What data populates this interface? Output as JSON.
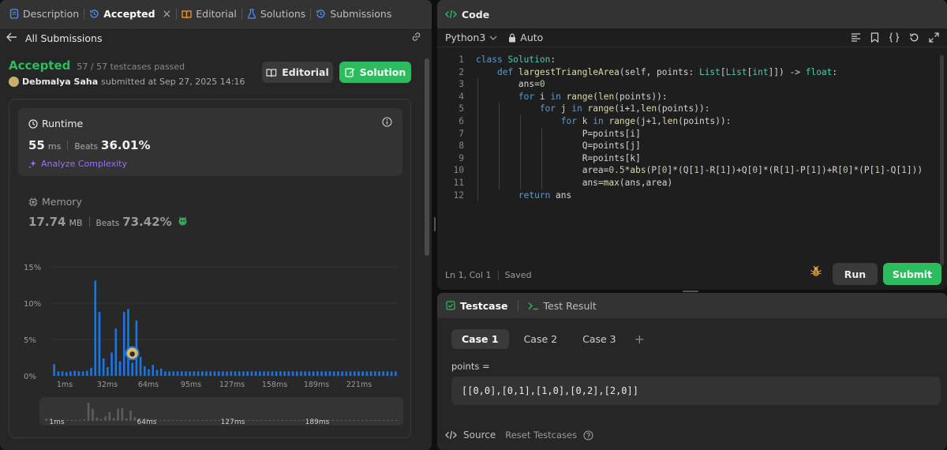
{
  "left_tabs": [
    {
      "label": "Description"
    },
    {
      "label": "Accepted"
    },
    {
      "label": "Editorial"
    },
    {
      "label": "Solutions"
    },
    {
      "label": "Submissions"
    }
  ],
  "back_label": "All Submissions",
  "submission": {
    "status": "Accepted",
    "testcases": "57 / 57 testcases passed",
    "author": "Debmalya Saha",
    "submitted_text": "submitted at Sep 27, 2025 14:16"
  },
  "buttons": {
    "editorial": "Editorial",
    "solution": "Solution"
  },
  "runtime": {
    "title": "Runtime",
    "value": "55",
    "unit": "ms",
    "beats_label": "Beats",
    "beats_value": "36.01%",
    "analyze": "Analyze Complexity"
  },
  "memory": {
    "title": "Memory",
    "value": "17.74",
    "unit": "MB",
    "beats_label": "Beats",
    "beats_value": "73.42%"
  },
  "chart_data": {
    "type": "bar",
    "y_ticks": [
      "15%",
      "10%",
      "5%",
      "0%"
    ],
    "ylim": [
      0,
      15
    ],
    "x_ticks": [
      "1ms",
      "32ms",
      "64ms",
      "95ms",
      "127ms",
      "158ms",
      "189ms",
      "221ms"
    ],
    "values": [
      1.6,
      0.6,
      0.6,
      0.5,
      0.6,
      0.7,
      0.6,
      0.6,
      0.7,
      1.1,
      13.1,
      8.8,
      2.4,
      1.2,
      3.2,
      6.5,
      2.0,
      8.8,
      9.2,
      1.8,
      7.6,
      2.6,
      1.3,
      0.9,
      1.5,
      0.8,
      1.0,
      0.6,
      0.6,
      0.6,
      0.6,
      0.6,
      0.6,
      0.6,
      0.6,
      0.6,
      0.6,
      0.6,
      0.6,
      0.6,
      0.6,
      0.6,
      0.6,
      0.6,
      0.6,
      0.6,
      0.6,
      0.6,
      0.6,
      0.6,
      0.6,
      0.6,
      0.6,
      0.6,
      0.6,
      0.6,
      0.6,
      0.6,
      0.6,
      0.6,
      0.6,
      0.6,
      0.6,
      0.6,
      0.6,
      0.6,
      0.6,
      0.6,
      0.6,
      0.6,
      0.6,
      0.6,
      0.6,
      0.6,
      0.6,
      0.6,
      0.6,
      0.6,
      0.6,
      0.6,
      0.6,
      0.6,
      0.6,
      0.6
    ],
    "highlight_index": 19,
    "bar_color": "#1a76e3",
    "grid": true,
    "mini_ticks": [
      "1ms",
      "64ms",
      "127ms",
      "189ms"
    ]
  },
  "code_panel": {
    "title": "Code",
    "language": "Python3",
    "mode": "Auto",
    "status_pos": "Ln 1, Col 1",
    "status_saved": "Saved",
    "run": "Run",
    "submit": "Submit"
  },
  "code_lines": [
    "class Solution:",
    "    def largestTriangleArea(self, points: List[List[int]]) -> float:",
    "        ans=0",
    "        for i in range(len(points)):",
    "            for j in range(i+1,len(points)):",
    "                for k in range(j+1,len(points)):",
    "                    P=points[i]",
    "                    Q=points[j]",
    "                    R=points[k]",
    "                    area=0.5*abs(P[0]*(Q[1]-R[1])+Q[0]*(R[1]-P[1])+R[0]*(P[1]-Q[1]))",
    "                    ans=max(ans,area)",
    "        return ans"
  ],
  "test_panel": {
    "tab_testcase": "Testcase",
    "tab_result": "Test Result",
    "cases": [
      "Case 1",
      "Case 2",
      "Case 3"
    ],
    "param_label": "points =",
    "param_value": "[[0,0],[0,1],[1,0],[0,2],[2,0]]",
    "source": "Source",
    "reset": "Reset Testcases"
  },
  "colors": {
    "accent_green": "#2cbb5d",
    "bar_blue": "#1a76e3",
    "purple": "#9b6dff"
  }
}
